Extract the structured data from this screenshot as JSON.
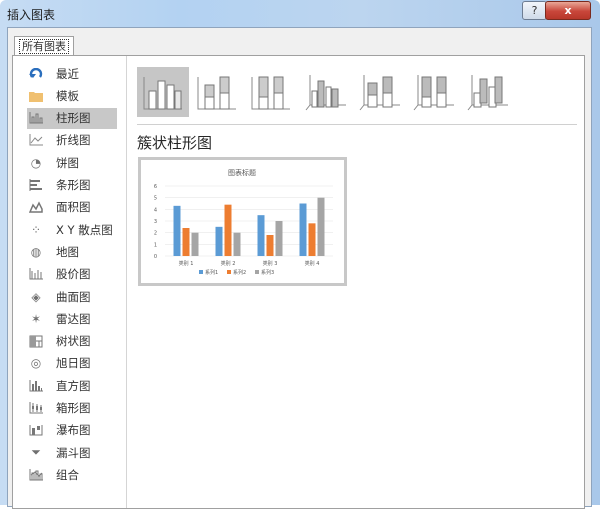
{
  "window": {
    "title": "插入图表",
    "help_label": "?",
    "close_label": "x"
  },
  "tabs": [
    {
      "label": "所有图表",
      "selected": true
    }
  ],
  "sidebar": {
    "items": [
      {
        "label": "最近",
        "icon": "recent-icon",
        "glyph": "↶"
      },
      {
        "label": "模板",
        "icon": "folder-icon",
        "glyph": ""
      },
      {
        "label": "柱形图",
        "icon": "column-chart-icon",
        "glyph": "",
        "selected": true
      },
      {
        "label": "折线图",
        "icon": "line-chart-icon",
        "glyph": ""
      },
      {
        "label": "饼图",
        "icon": "pie-chart-icon",
        "glyph": "◔"
      },
      {
        "label": "条形图",
        "icon": "bar-chart-icon",
        "glyph": ""
      },
      {
        "label": "面积图",
        "icon": "area-chart-icon",
        "glyph": ""
      },
      {
        "label": "X Y 散点图",
        "icon": "scatter-chart-icon",
        "glyph": "⁘"
      },
      {
        "label": "地图",
        "icon": "map-chart-icon",
        "glyph": "◍"
      },
      {
        "label": "股价图",
        "icon": "stock-chart-icon",
        "glyph": ""
      },
      {
        "label": "曲面图",
        "icon": "surface-chart-icon",
        "glyph": "◈"
      },
      {
        "label": "雷达图",
        "icon": "radar-chart-icon",
        "glyph": "✶"
      },
      {
        "label": "树状图",
        "icon": "treemap-chart-icon",
        "glyph": ""
      },
      {
        "label": "旭日图",
        "icon": "sunburst-chart-icon",
        "glyph": "◎"
      },
      {
        "label": "直方图",
        "icon": "histogram-chart-icon",
        "glyph": ""
      },
      {
        "label": "箱形图",
        "icon": "box-whisker-chart-icon",
        "glyph": ""
      },
      {
        "label": "瀑布图",
        "icon": "waterfall-chart-icon",
        "glyph": ""
      },
      {
        "label": "漏斗图",
        "icon": "funnel-chart-icon",
        "glyph": "⏷"
      },
      {
        "label": "组合",
        "icon": "combo-chart-icon",
        "glyph": ""
      }
    ]
  },
  "subtypes": [
    {
      "name": "clustered-column",
      "selected": true
    },
    {
      "name": "stacked-column"
    },
    {
      "name": "100-stacked-column"
    },
    {
      "name": "3d-clustered-column"
    },
    {
      "name": "3d-stacked-column"
    },
    {
      "name": "3d-100-stacked-column"
    },
    {
      "name": "3d-column"
    }
  ],
  "selected_subtype_label": "簇状柱形图",
  "chart_data": {
    "type": "bar",
    "title": "图表标题",
    "categories": [
      "类别 1",
      "类别 2",
      "类别 3",
      "类别 4"
    ],
    "series": [
      {
        "name": "系列1",
        "values": [
          4.3,
          2.5,
          3.5,
          4.5
        ],
        "color": "#5b9bd5"
      },
      {
        "name": "系列2",
        "values": [
          2.4,
          4.4,
          1.8,
          2.8
        ],
        "color": "#ed7d31"
      },
      {
        "name": "系列3",
        "values": [
          2,
          2,
          3,
          5
        ],
        "color": "#a5a5a5"
      }
    ],
    "yticks": [
      "0",
      "1",
      "2",
      "3",
      "4",
      "5",
      "6"
    ],
    "ylim": [
      0,
      6
    ],
    "grid": true,
    "legend": "bottom",
    "xlabel": "",
    "ylabel": ""
  }
}
